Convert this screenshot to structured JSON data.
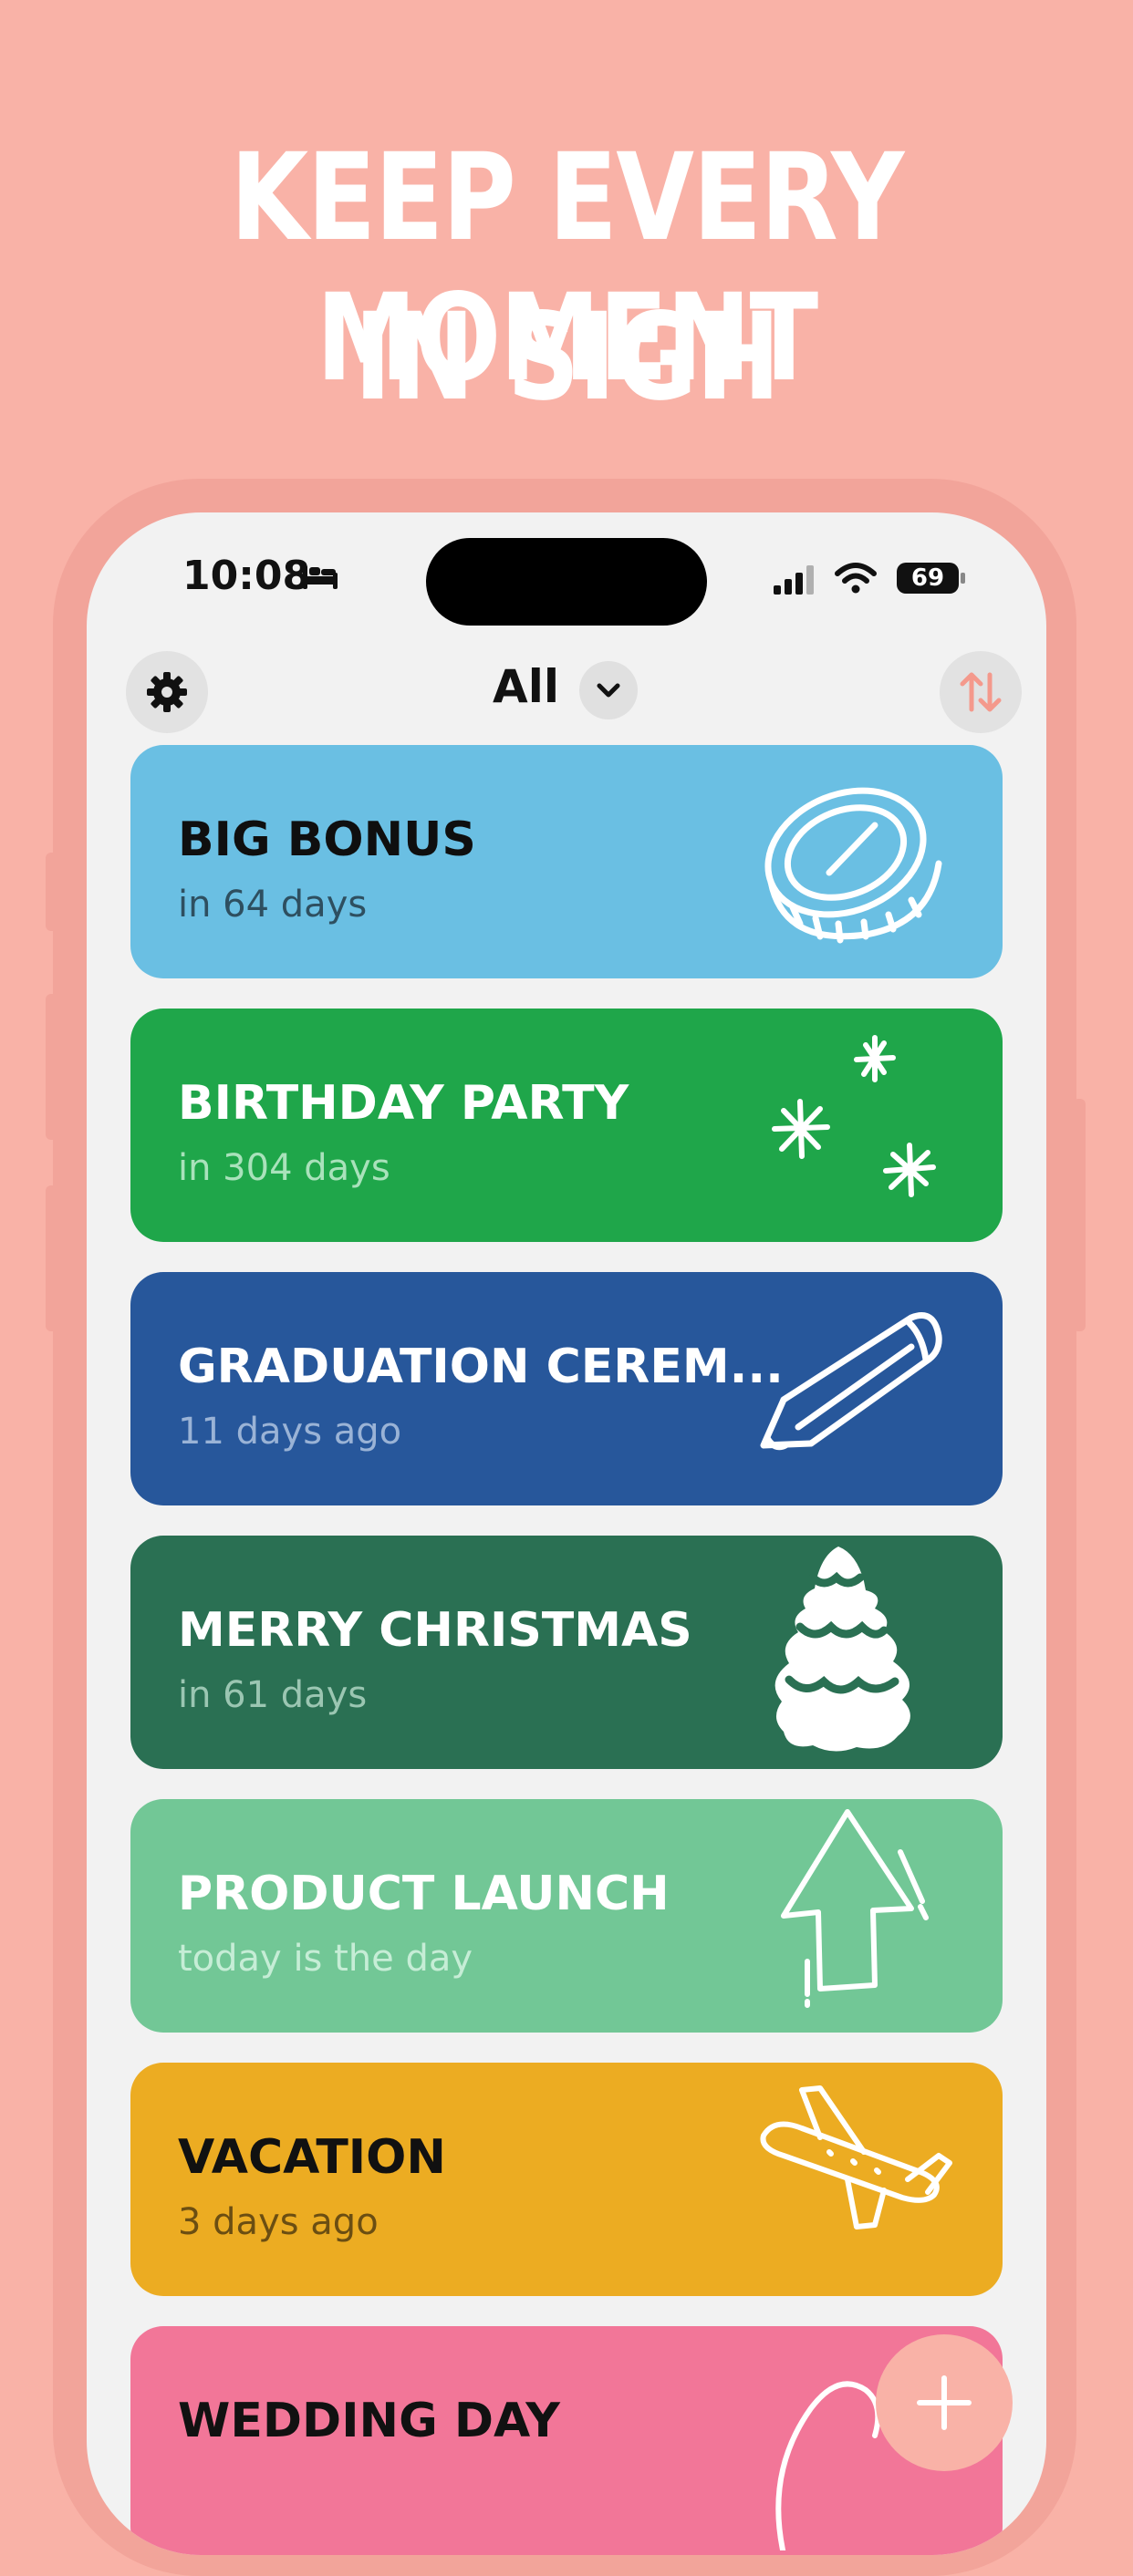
{
  "promo": {
    "line1": "KEEP EVERY MOMENT",
    "line2": "IN SIGH"
  },
  "status_bar": {
    "time": "10:08",
    "battery": "69"
  },
  "toolbar": {
    "filter_label": "All"
  },
  "cards": [
    {
      "title": "BIG BONUS",
      "subtitle": "in 64 days",
      "color": "#6ABFE3",
      "icon": "coin-icon"
    },
    {
      "title": "BIRTHDAY PARTY",
      "subtitle": "in 304 days",
      "color": "#1FA64A",
      "icon": "sparkles-icon"
    },
    {
      "title": "GRADUATION CEREM...",
      "subtitle": "11 days ago",
      "color": "#27579B",
      "icon": "pencil-icon"
    },
    {
      "title": "MERRY CHRISTMAS",
      "subtitle": "in 61 days",
      "color": "#2A7053",
      "icon": "tree-icon"
    },
    {
      "title": "PRODUCT LAUNCH",
      "subtitle": "today is the day",
      "color": "#72C796",
      "icon": "arrow-up-icon"
    },
    {
      "title": "VACATION",
      "subtitle": "3 days ago",
      "color": "#ECAC22",
      "icon": "airplane-icon"
    },
    {
      "title": "WEDDING DAY",
      "subtitle": "",
      "color": "#F27698",
      "icon": "heart-icon"
    }
  ]
}
